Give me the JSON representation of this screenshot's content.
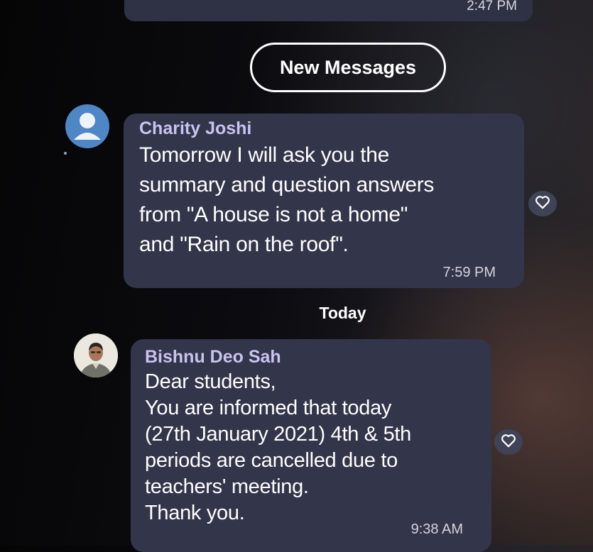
{
  "previous_message": {
    "time": "2:47 PM"
  },
  "new_messages_label": "New Messages",
  "messages": [
    {
      "sender": "Charity Joshi",
      "text": "Tomorrow I will ask you the\nsummary and question answers\nfrom \"A house is not a home\"\nand \"Rain on the roof\".",
      "time": "7:59 PM",
      "avatar": "default-person-icon"
    },
    {
      "sender": "Bishnu Deo Sah",
      "text": "Dear students,\nYou are informed that today\n(27th January 2021) 4th & 5th\nperiods are cancelled due to\nteachers' meeting.\nThank you.",
      "time": "9:38 AM",
      "avatar": "profile-photo"
    }
  ],
  "day_divider": "Today",
  "icons": {
    "react": "heart-icon"
  },
  "colors": {
    "bubble": "#33354a",
    "sender_name": "#c9c3f0",
    "avatar_default": "#4f86c6"
  }
}
